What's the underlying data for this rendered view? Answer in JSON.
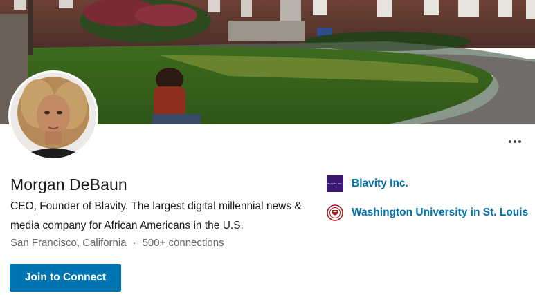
{
  "profile": {
    "name": "Morgan DeBaun",
    "headline": "CEO, Founder of Blavity. The largest digital millennial news & media company for African Americans in the U.S.",
    "location": "San Francisco, California",
    "separator": "·",
    "connections": "500+ connections"
  },
  "actions": {
    "join_label": "Join to Connect",
    "more_icon": "more-options-icon"
  },
  "experience": {
    "company": {
      "name": "Blavity Inc.",
      "logo_text": "BLAVITY INC."
    },
    "school": {
      "name": "Washington University in St. Louis"
    }
  },
  "colors": {
    "accent": "#0073b1",
    "company_logo_bg": "#3a1873",
    "school_crest": "#a51417"
  }
}
